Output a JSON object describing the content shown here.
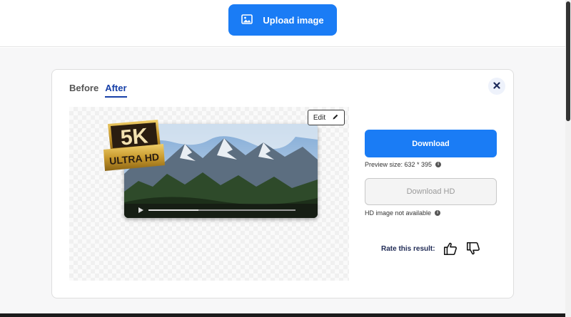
{
  "header": {
    "upload_label": "Upload image",
    "upload_icon": "image-icon"
  },
  "result_card": {
    "tabs": [
      {
        "label": "Before",
        "active": false
      },
      {
        "label": "After",
        "active": true
      }
    ],
    "close_icon": "close-icon",
    "edit_label": "Edit",
    "edit_icon": "pencil-icon",
    "badge": {
      "line1": "5K",
      "line2": "ULTRA HD"
    },
    "download_label": "Download",
    "preview_size_text": "Preview size: 632 * 395",
    "download_hd_label": "Download HD",
    "hd_note": "HD image not available",
    "rate_label": "Rate this result:",
    "rate_icons": [
      "thumbs-up-icon",
      "thumbs-down-icon"
    ]
  },
  "colors": {
    "primary": "#1a7cf5",
    "tab_active": "#1740a8",
    "rate_text": "#1f2a55",
    "badge_gold": "#c99a2e",
    "badge_dark": "#2a1d10"
  }
}
